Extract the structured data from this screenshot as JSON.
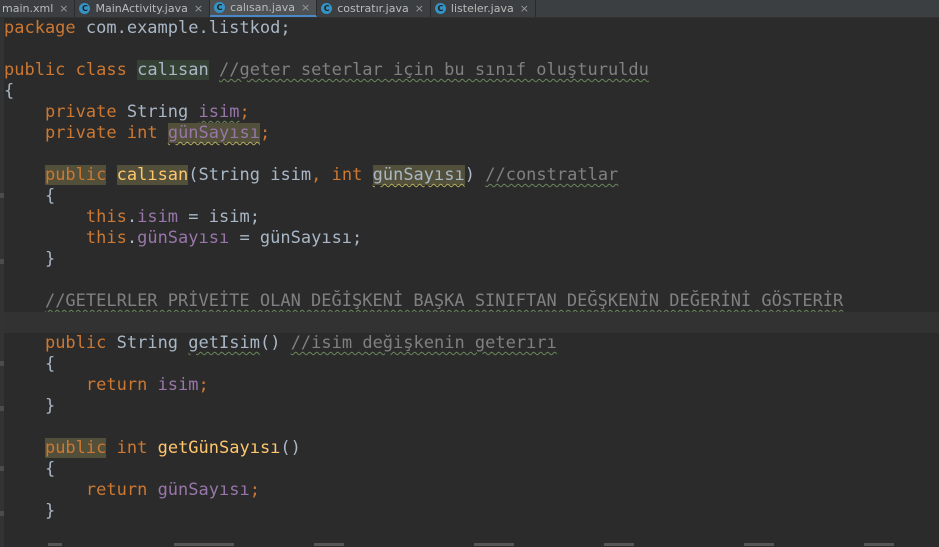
{
  "tabs": [
    {
      "label": "main.xml",
      "icon": null,
      "active": false
    },
    {
      "label": "MainActivity.java",
      "icon": "java-class-icon",
      "active": false
    },
    {
      "label": "calısan.java",
      "icon": "java-class-icon",
      "active": true
    },
    {
      "label": "costratır.java",
      "icon": "java-class-icon",
      "active": false
    },
    {
      "label": "listeler.java",
      "icon": "java-class-icon",
      "active": false
    }
  ],
  "tab_close_glyph": "×",
  "tab_icon_glyph": "C",
  "code": {
    "l1": {
      "kw": "package",
      "rest": " com.example.listkod;"
    },
    "l3": {
      "kw1": "public",
      "kw2": "class",
      "cls": "calısan",
      "cmt": "//geter seterlar için bu sınıf oluşturuldu"
    },
    "l4": {
      "brace": "{"
    },
    "l5": {
      "kw": "private",
      "type": "String",
      "field": "isim",
      "semi": ";"
    },
    "l6": {
      "kw1": "private",
      "kw2": "int",
      "field": "günSayısı",
      "semi": ";"
    },
    "l8": {
      "kw": "public",
      "ctor": "calısan",
      "open": "(",
      "t1": "String",
      "p1": "isim",
      "comma": ", ",
      "t2": "int",
      "p2": "günSayısı",
      "close": ")",
      "cmt": "//constratlar"
    },
    "l9": {
      "brace": "{"
    },
    "l10": {
      "kw": "this",
      "dot": ".",
      "field": "isim",
      "rest": " = isim;"
    },
    "l11": {
      "kw": "this",
      "dot": ".",
      "field": "günSayısı",
      "rest": " = günSayısı;"
    },
    "l12": {
      "brace": "}"
    },
    "l14": {
      "cmt": "//GETELRLER PRİVEİTE OLAN DEĞİŞKENİ BAŞKA SINIFTAN DEĞŞKENİN DEĞERİNİ GÖSTERİR"
    },
    "l16": {
      "kw": "public",
      "type": "String",
      "fn": "getIsim",
      "parens": "()",
      "cmt": "//isim değişkenin geterırı"
    },
    "l17": {
      "brace": "{"
    },
    "l18": {
      "kw": "return",
      "field": "isim",
      "semi": ";"
    },
    "l19": {
      "brace": "}"
    },
    "l21": {
      "kw1": "public",
      "kw2": "int",
      "fn": "getGünSayısı",
      "parens": "()"
    },
    "l22": {
      "brace": "{"
    },
    "l23": {
      "kw": "return",
      "field": "günSayısı",
      "semi": ";"
    },
    "l24": {
      "brace": "}"
    }
  },
  "colors": {
    "background": "#2b2b2b",
    "keyword": "#cc7832",
    "text": "#a9b7c6",
    "field": "#9876aa",
    "method": "#ffc66d",
    "comment": "#808080",
    "tab_icon": "#3592c4"
  }
}
